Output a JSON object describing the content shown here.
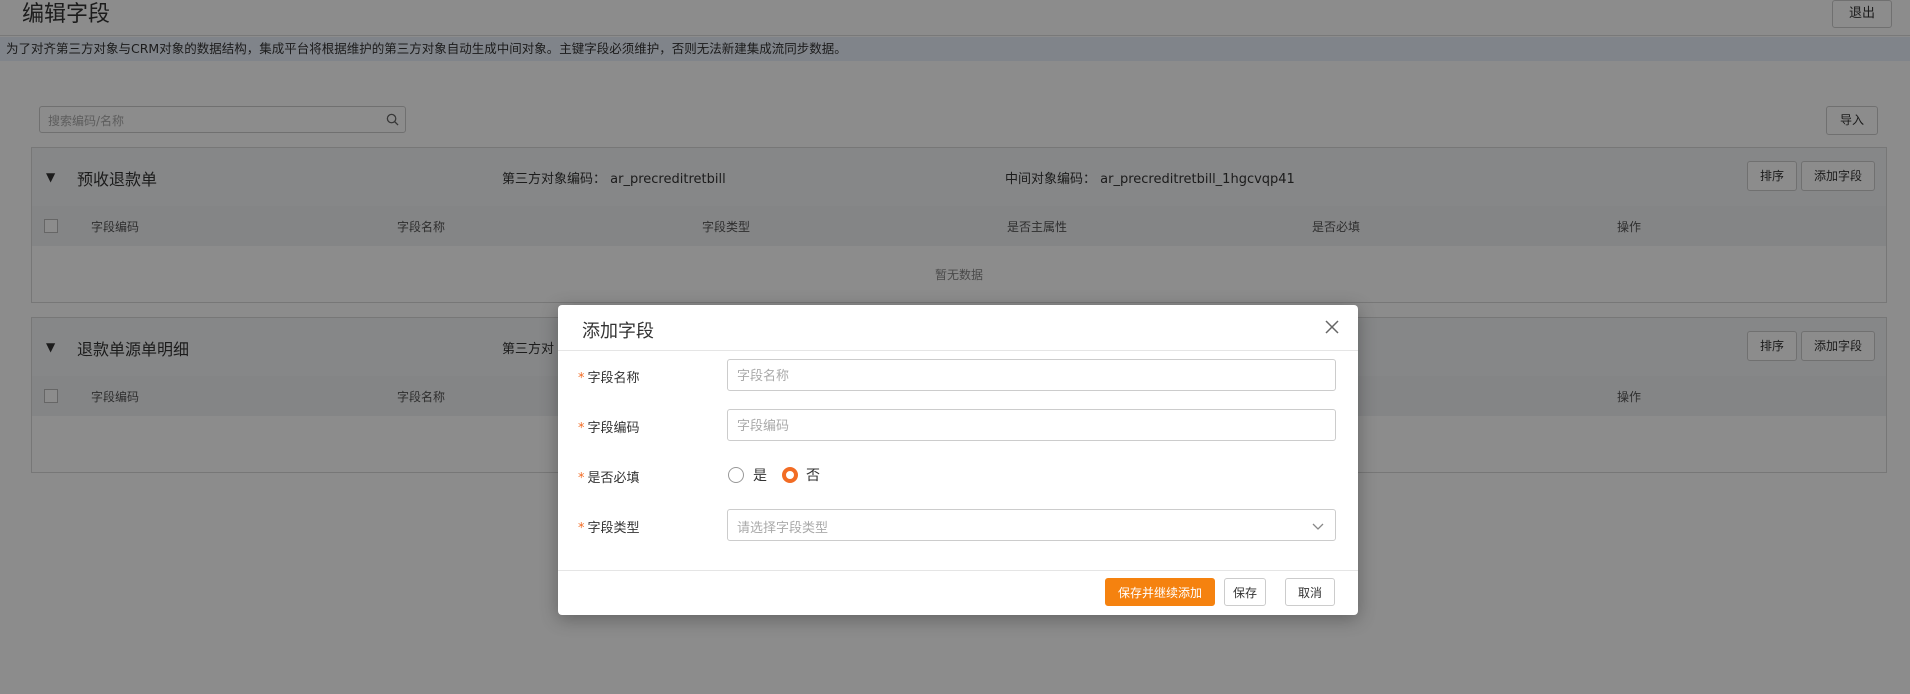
{
  "header": {
    "title": "编辑字段",
    "exit_label": "退出",
    "notice": "为了对齐第三方对象与CRM对象的数据结构，集成平台将根据维护的第三方对象自动生成中间对象。主键字段必须维护，否则无法新建集成流同步数据。"
  },
  "search": {
    "placeholder": "搜索编码/名称",
    "import_label": "导入"
  },
  "sections": [
    {
      "title": "预收退款单",
      "third_party_label": "第三方对象编码：",
      "third_party_code": "ar_precreditretbill",
      "middle_label": "中间对象编码：",
      "middle_code": "ar_precreditretbill_1hgcvqp41",
      "sort_label": "排序",
      "add_label": "添加字段",
      "empty_text": "暂无数据"
    },
    {
      "title": "退款单源单明细",
      "third_party_label": "第三方对",
      "sort_label": "排序",
      "add_label": "添加字段"
    }
  ],
  "table": {
    "columns": [
      "字段编码",
      "字段名称",
      "字段类型",
      "是否主属性",
      "是否必填",
      "操作"
    ]
  },
  "modal": {
    "title": "添加字段",
    "fields": {
      "name_label": "字段名称",
      "name_placeholder": "字段名称",
      "code_label": "字段编码",
      "code_placeholder": "字段编码",
      "required_label": "是否必填",
      "required_yes": "是",
      "required_no": "否",
      "required_value": "否",
      "type_label": "字段类型",
      "type_placeholder": "请选择字段类型"
    },
    "buttons": {
      "save_continue": "保存并继续添加",
      "save": "保存",
      "cancel": "取消"
    }
  },
  "colors": {
    "accent": "#f5820f",
    "radio_active": "#f26c24",
    "required_star": "#f26c24"
  }
}
